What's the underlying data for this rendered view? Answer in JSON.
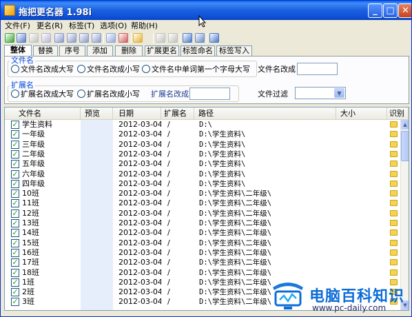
{
  "window": {
    "title": "拖把更名器 1.98i"
  },
  "title_buttons": {
    "minimize": "_",
    "maximize": "□",
    "close": "✕"
  },
  "menu": [
    "文件(F)",
    "更名(R)",
    "标签(T)",
    "选项(O)",
    "帮助(H)"
  ],
  "toolbar_icons": [
    {
      "name": "refresh-green-icon",
      "color": "#3aa43a"
    },
    {
      "name": "search-icon",
      "color": "#5a7dc8"
    },
    {
      "name": "undo-icon",
      "color": "#c0c0c0"
    },
    {
      "name": "check-icon",
      "color": "#b4b4d6"
    },
    {
      "name": "move-up-icon",
      "color": "#8a9ac8"
    },
    {
      "name": "move-down-icon",
      "color": "#8a9ac8"
    },
    {
      "name": "list-up-icon",
      "color": "#8a9ac8"
    },
    {
      "name": "list-down-icon",
      "color": "#8a9ac8"
    },
    {
      "name": "document-icon",
      "color": "#8fa8d8"
    },
    {
      "name": "document-red-icon",
      "color": "#d06060"
    },
    {
      "name": "highlight-icon",
      "color": "#e0b030"
    },
    {
      "name": "tag-icon",
      "color": "#c0c0c0"
    },
    {
      "name": "tag-edit-icon",
      "color": "#c0c0c0"
    },
    {
      "name": "clock-icon",
      "color": "#4a78c8"
    },
    {
      "name": "window-icon",
      "color": "#6a8ac8"
    },
    {
      "name": "tools-icon",
      "color": "#4a78c8"
    }
  ],
  "tabs": [
    "整体",
    "替换",
    "序号",
    "添加",
    "删除",
    "扩展更名",
    "标签命名",
    "标签写入"
  ],
  "filename_group": {
    "label": "文件名",
    "options": [
      "文件名改成大写",
      "文件名改成小写",
      "文件名中单词第一个字母大写"
    ],
    "rename_label": "文件名改成",
    "rename_value": ""
  },
  "ext_group": {
    "label": "扩展名",
    "options": [
      "扩展名改成大写",
      "扩展名改成小写"
    ],
    "rename_label": "扩展名改成",
    "rename_value": ""
  },
  "filter": {
    "label": "文件过滤",
    "value": ""
  },
  "columns": [
    "文件名",
    "预览",
    "日期",
    "扩展名",
    "路径",
    "大小",
    "识别"
  ],
  "rows": [
    {
      "name": "学生资料",
      "date": "2012-03-04",
      "ext": "/",
      "path": "D:\\"
    },
    {
      "name": "一年级",
      "date": "2012-03-04",
      "ext": "/",
      "path": "D:\\学生资料\\"
    },
    {
      "name": "三年级",
      "date": "2012-03-04",
      "ext": "/",
      "path": "D:\\学生资料\\"
    },
    {
      "name": "二年级",
      "date": "2012-03-04",
      "ext": "/",
      "path": "D:\\学生资料\\"
    },
    {
      "name": "五年级",
      "date": "2012-03-04",
      "ext": "/",
      "path": "D:\\学生资料\\"
    },
    {
      "name": "六年级",
      "date": "2012-03-04",
      "ext": "/",
      "path": "D:\\学生资料\\"
    },
    {
      "name": "四年级",
      "date": "2012-03-04",
      "ext": "/",
      "path": "D:\\学生资料\\"
    },
    {
      "name": "10班",
      "date": "2012-03-04",
      "ext": "/",
      "path": "D:\\学生资料\\二年级\\"
    },
    {
      "name": "11班",
      "date": "2012-03-04",
      "ext": "/",
      "path": "D:\\学生资料\\二年级\\"
    },
    {
      "name": "12班",
      "date": "2012-03-04",
      "ext": "/",
      "path": "D:\\学生资料\\二年级\\"
    },
    {
      "name": "13班",
      "date": "2012-03-04",
      "ext": "/",
      "path": "D:\\学生资料\\二年级\\"
    },
    {
      "name": "14班",
      "date": "2012-03-04",
      "ext": "/",
      "path": "D:\\学生资料\\二年级\\"
    },
    {
      "name": "15班",
      "date": "2012-03-04",
      "ext": "/",
      "path": "D:\\学生资料\\二年级\\"
    },
    {
      "name": "16班",
      "date": "2012-03-04",
      "ext": "/",
      "path": "D:\\学生资料\\二年级\\"
    },
    {
      "name": "17班",
      "date": "2012-03-04",
      "ext": "/",
      "path": "D:\\学生资料\\二年级\\"
    },
    {
      "name": "18班",
      "date": "2012-03-04",
      "ext": "/",
      "path": "D:\\学生资料\\二年级\\"
    },
    {
      "name": "1班",
      "date": "2012-03-04",
      "ext": "/",
      "path": "D:\\学生资料\\二年级\\"
    },
    {
      "name": "2班",
      "date": "2012-03-04",
      "ext": "/",
      "path": "D:\\学生资料\\二年级\\"
    },
    {
      "name": "3班",
      "date": "2012-03-04",
      "ext": "/",
      "path": "D:\\学生资料\\二年级\\"
    }
  ],
  "checkmark": "✓",
  "watermark": {
    "title": "电脑百科知识",
    "url": "www.pc-daily.com"
  },
  "colors": {
    "titlebar": "#0a4fd6",
    "folder": "#f6d34e",
    "accent_label": "#0046d5"
  }
}
